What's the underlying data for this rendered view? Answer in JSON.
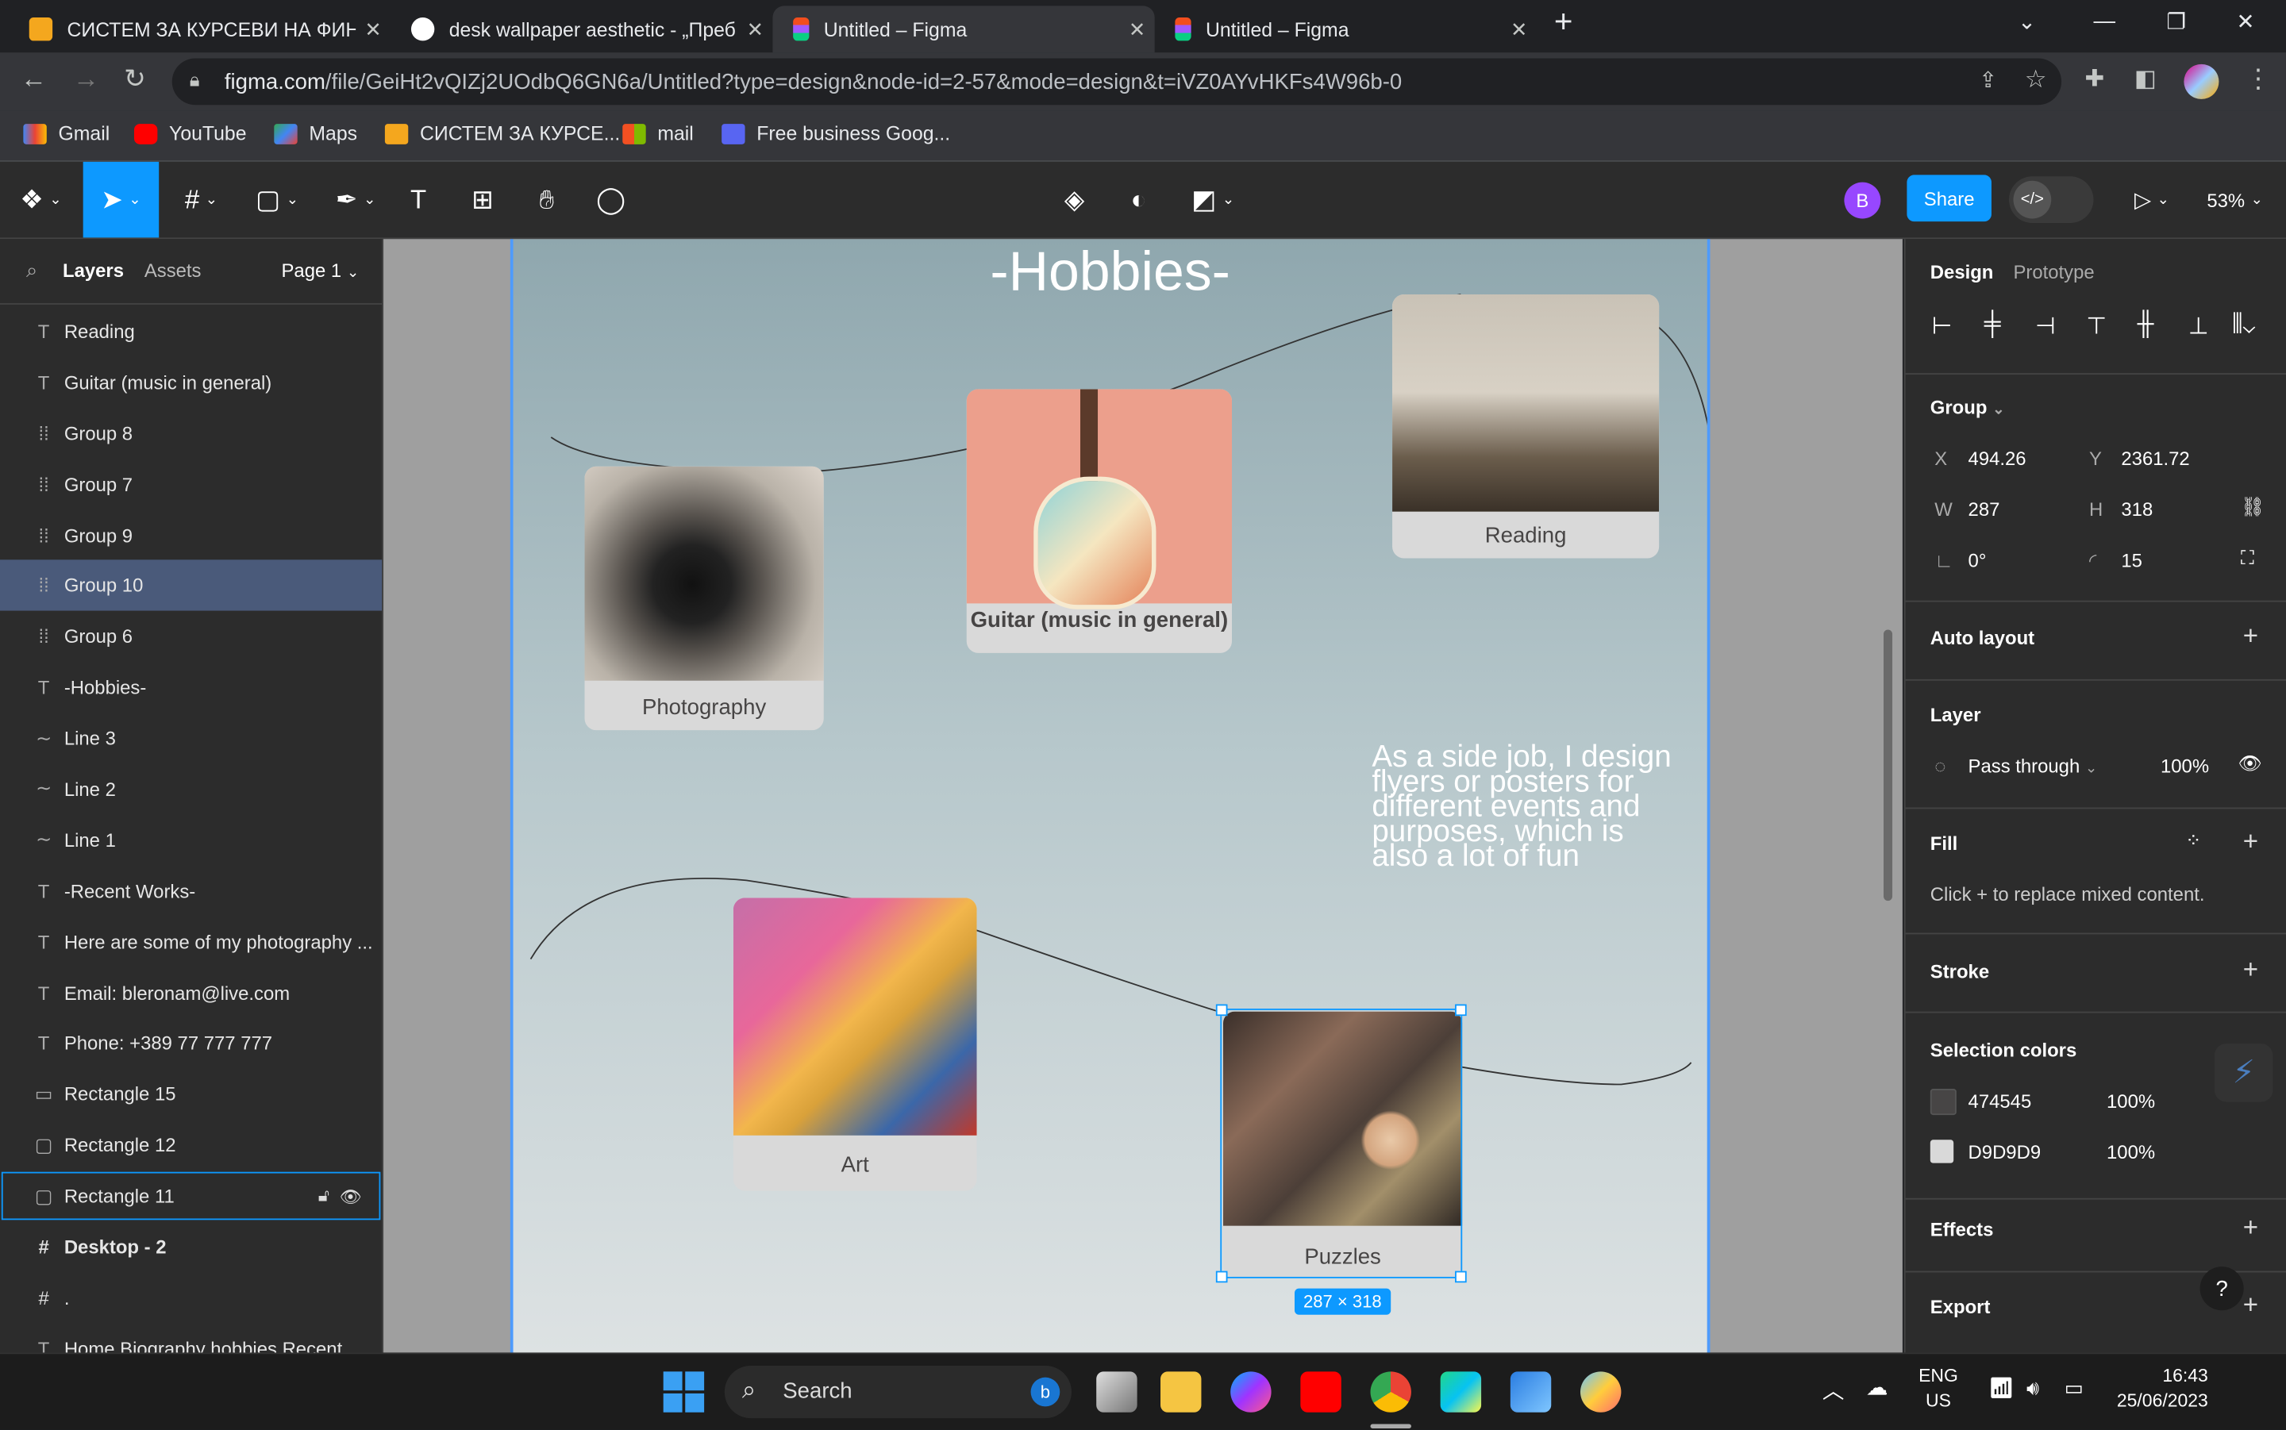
{
  "browser": {
    "tabs": [
      {
        "title": "СИСТЕМ ЗА КУРСЕВИ НА ФИНК",
        "active": false
      },
      {
        "title": "desk wallpaper aesthetic - „Преб",
        "active": false
      },
      {
        "title": "Untitled – Figma",
        "active": true
      },
      {
        "title": "Untitled – Figma",
        "active": false
      }
    ],
    "url_domain": "figma.com",
    "url_path": "/file/GeiHt2vQIZj2UOdbQ6GN6a/Untitled?type=design&node-id=2-57&mode=design&t=iVZ0AYvHKFs4W96b-0",
    "bookmarks": [
      "Gmail",
      "YouTube",
      "Maps",
      "СИСТЕМ ЗА КУРСЕ...",
      "mail",
      "Free business Goog..."
    ]
  },
  "figma_toolbar": {
    "share_label": "Share",
    "avatar_letter": "B",
    "zoom": "53%"
  },
  "left_panel": {
    "tab_layers": "Layers",
    "tab_assets": "Assets",
    "page": "Page 1",
    "layers": [
      {
        "type": "text",
        "name": "Reading"
      },
      {
        "type": "text",
        "name": "Guitar (music in general)"
      },
      {
        "type": "group",
        "name": "Group 8"
      },
      {
        "type": "group",
        "name": "Group 7"
      },
      {
        "type": "group",
        "name": "Group 9"
      },
      {
        "type": "group",
        "name": "Group 10"
      },
      {
        "type": "group",
        "name": "Group 6"
      },
      {
        "type": "text",
        "name": "-Hobbies-"
      },
      {
        "type": "line",
        "name": "Line 3"
      },
      {
        "type": "line",
        "name": "Line 2"
      },
      {
        "type": "line",
        "name": "Line 1"
      },
      {
        "type": "text",
        "name": "-Recent Works-"
      },
      {
        "type": "text",
        "name": "Here are some of my photography ..."
      },
      {
        "type": "text",
        "name": "Email: bleronam@live.com"
      },
      {
        "type": "text",
        "name": "Phone: +389 77 777 777"
      },
      {
        "type": "rect",
        "name": "Rectangle 15"
      },
      {
        "type": "rect",
        "name": "Rectangle 12"
      },
      {
        "type": "rect",
        "name": "Rectangle 11"
      },
      {
        "type": "frame",
        "name": "Desktop - 2"
      },
      {
        "type": "frame",
        "name": "."
      },
      {
        "type": "text",
        "name": "Home Biography hobbies Recent ..."
      }
    ]
  },
  "canvas": {
    "heading": "-Hobbies-",
    "cards": {
      "photography": "Photography",
      "guitar": "Guitar (music in general)",
      "reading": "Reading",
      "art": "Art",
      "puzzles": "Puzzles"
    },
    "side_job_text": "As a side job, I design flyers or posters for different events and purposes, which is also a lot of fun",
    "selection_size": "287 × 318"
  },
  "right_panel": {
    "tab_design": "Design",
    "tab_prototype": "Prototype",
    "selection_type": "Group",
    "x_label": "X",
    "x_value": "494.26",
    "y_label": "Y",
    "y_value": "2361.72",
    "w_label": "W",
    "w_value": "287",
    "h_label": "H",
    "h_value": "318",
    "rotation": "0°",
    "radius": "15",
    "auto_layout": "Auto layout",
    "layer_title": "Layer",
    "blend_mode": "Pass through",
    "opacity": "100%",
    "fill_title": "Fill",
    "fill_hint": "Click + to replace mixed content.",
    "stroke_title": "Stroke",
    "selection_colors_title": "Selection colors",
    "selection_colors": [
      {
        "hex": "474545",
        "opacity": "100%",
        "color": "#474545"
      },
      {
        "hex": "D9D9D9",
        "opacity": "100%",
        "color": "#D9D9D9"
      }
    ],
    "effects_title": "Effects",
    "export_title": "Export"
  },
  "taskbar": {
    "search_placeholder": "Search",
    "lang_top": "ENG",
    "lang_bottom": "US",
    "time": "16:43",
    "date": "25/06/2023"
  }
}
